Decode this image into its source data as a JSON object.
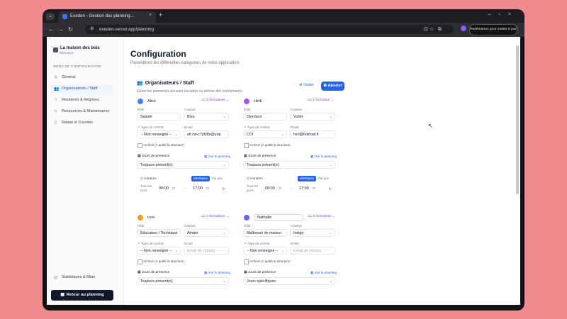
{
  "browser": {
    "tab_title": "Exeden - Gestion des planning...",
    "url": "exeden.vercel.app/planning",
    "relaunch_label": "Redémarrez pour mettre à jour"
  },
  "sidebar": {
    "brand_title": "La maison des bois",
    "brand_subtitle": "Directeur",
    "section_label": "MENU DE CONFIGURATION",
    "items": [
      {
        "label": "Général",
        "icon": "gear-icon"
      },
      {
        "label": "Organisateurs / Staff",
        "icon": "users-icon"
      },
      {
        "label": "Résidents & Régimes",
        "icon": "user-icon"
      },
      {
        "label": "Ressources & Maintenance",
        "icon": "wrench-icon"
      },
      {
        "label": "Repas et Courses",
        "icon": "cart-icon"
      }
    ],
    "stats_label": "Statistiques & Bilan",
    "back_label": "Retour au planning"
  },
  "main": {
    "title": "Configuration",
    "subtitle": "Paramétrez les différentes catégories de votre application."
  },
  "staff_card": {
    "title": "Organisateurs / Staff",
    "subtitle": "Gérez les personnes pouvant encadrer ou animer des événements.",
    "invite_label": "Inviter",
    "add_label": "Ajouter"
  },
  "labels": {
    "role": "Rôle",
    "color": "Couleur",
    "contract": "Type de contrat",
    "email": "Email",
    "archive": "Archivé (A quitté la structure)",
    "presence_days": "Jours de présence",
    "view_planning": "Voir le planning",
    "hours": "Horaires",
    "identical": "Identiques",
    "per_day": "Par jour",
    "all_days_line1": "Tous les",
    "all_days_line2": "jours",
    "fn": "fn"
  },
  "people": [
    {
      "name": "Alice",
      "dot_color": "#3b82f6",
      "formations": "0 formations",
      "role": "Salarié",
      "color": "Bleu",
      "contract": "-- Non renseigné --",
      "email": "alt.cw-c7yty8n@yop",
      "email_placeholder": false,
      "presence": "Toujours présent(e)",
      "start": "09:00",
      "end": "17:00"
    },
    {
      "name": "Hédi",
      "dot_color": "#a855f7",
      "formations": "1 formation",
      "role": "Directeur",
      "color": "Violet",
      "contract": "CDI",
      "email": "hxn@hotmail.fr",
      "email_placeholder": false,
      "presence": "Toujours présent(e)",
      "start": "09:00",
      "end": "17:00"
    },
    {
      "name": "Icon",
      "dot_color": "#f59e0b",
      "formations": "0 formations",
      "role": "Éducateur / Technique",
      "color": "Ambre",
      "contract": "-- Non renseigné --",
      "email": "Email de contact",
      "email_placeholder": true,
      "presence": "Toujours présent(e)"
    },
    {
      "name": "Nathalie",
      "dot_color": "#6366f1",
      "formations": "0 formations",
      "role": "Maîtresse de maison",
      "color": "Indigo",
      "contract": "-- Non renseigné --",
      "email": "Email de contact",
      "email_placeholder": true,
      "presence": "Jours spécifiques"
    }
  ]
}
